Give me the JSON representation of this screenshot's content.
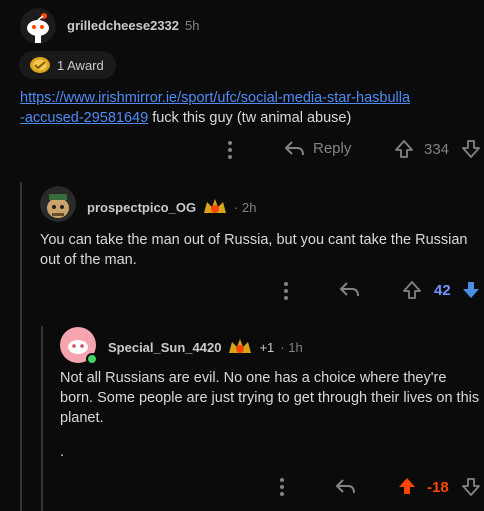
{
  "comment1": {
    "username": "grilledcheese2332",
    "time": "5h",
    "award_label": "1 Award",
    "link_line1": "https://www.irishmirror.ie/sport/ufc/social-media-star-hasbulla",
    "link_line2": "-accused-29581649",
    "text_after_link": "fuck this guy (tw animal abuse)",
    "reply_label": "Reply",
    "score": "334"
  },
  "comment2": {
    "username": "prospectpico_OG",
    "time": "2h",
    "body": "You can take the man out of Russia,  but you cant take the Russian out of the man.",
    "score": "42"
  },
  "comment3": {
    "username": "Special_Sun_4420",
    "award_count": "+1",
    "time": "1h",
    "body": "Not all Russians are evil. No one has a choice where they're born. Some people are just trying to get through their lives on this planet.",
    "trailing": ".",
    "score": "-18"
  },
  "colors": {
    "upvote_active": "#ff4500",
    "downvote_active": "#7193ff",
    "link": "#4f8cf7"
  }
}
